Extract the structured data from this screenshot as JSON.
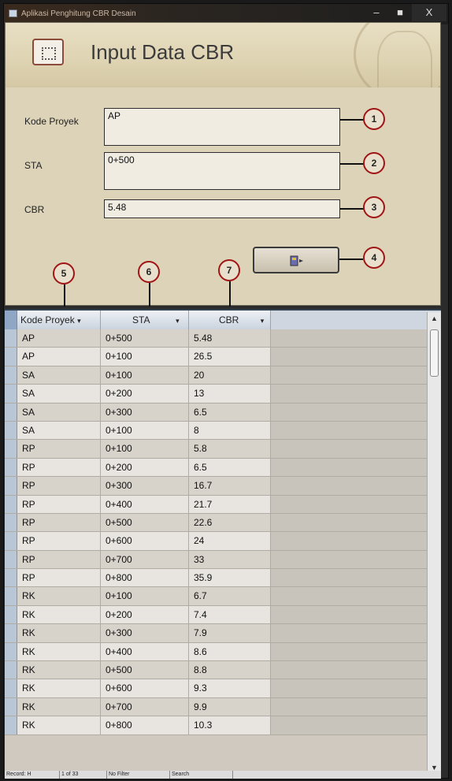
{
  "window": {
    "title": "Aplikasi Penghitung CBR Desain",
    "minimize": "–",
    "maximize": "■",
    "close": "X"
  },
  "header": {
    "title": "Input Data CBR"
  },
  "form": {
    "kode_label": "Kode Proyek",
    "kode_value": "AP",
    "sta_label": "STA",
    "sta_value": "0+500",
    "cbr_label": "CBR",
    "cbr_value": "5.48"
  },
  "callouts": [
    "1",
    "2",
    "3",
    "4",
    "5",
    "6",
    "7"
  ],
  "grid": {
    "columns": [
      "Kode Proyek",
      "STA",
      "CBR"
    ],
    "rows": [
      {
        "kode": "AP",
        "sta": "0+500",
        "cbr": "5.48"
      },
      {
        "kode": "AP",
        "sta": "0+100",
        "cbr": "26.5"
      },
      {
        "kode": "SA",
        "sta": "0+100",
        "cbr": "20"
      },
      {
        "kode": "SA",
        "sta": "0+200",
        "cbr": "13"
      },
      {
        "kode": "SA",
        "sta": "0+300",
        "cbr": "6.5"
      },
      {
        "kode": "SA",
        "sta": "0+100",
        "cbr": "8"
      },
      {
        "kode": "RP",
        "sta": "0+100",
        "cbr": "5.8"
      },
      {
        "kode": "RP",
        "sta": "0+200",
        "cbr": "6.5"
      },
      {
        "kode": "RP",
        "sta": "0+300",
        "cbr": "16.7"
      },
      {
        "kode": "RP",
        "sta": "0+400",
        "cbr": "21.7"
      },
      {
        "kode": "RP",
        "sta": "0+500",
        "cbr": "22.6"
      },
      {
        "kode": "RP",
        "sta": "0+600",
        "cbr": "24"
      },
      {
        "kode": "RP",
        "sta": "0+700",
        "cbr": "33"
      },
      {
        "kode": "RP",
        "sta": "0+800",
        "cbr": "35.9"
      },
      {
        "kode": "RK",
        "sta": "0+100",
        "cbr": "6.7"
      },
      {
        "kode": "RK",
        "sta": "0+200",
        "cbr": "7.4"
      },
      {
        "kode": "RK",
        "sta": "0+300",
        "cbr": "7.9"
      },
      {
        "kode": "RK",
        "sta": "0+400",
        "cbr": "8.6"
      },
      {
        "kode": "RK",
        "sta": "0+500",
        "cbr": "8.8"
      },
      {
        "kode": "RK",
        "sta": "0+600",
        "cbr": "9.3"
      },
      {
        "kode": "RK",
        "sta": "0+700",
        "cbr": "9.9"
      },
      {
        "kode": "RK",
        "sta": "0+800",
        "cbr": "10.3"
      }
    ]
  },
  "statusbar": [
    "Record: H",
    "1 of 33",
    "No Filter",
    "Search"
  ]
}
